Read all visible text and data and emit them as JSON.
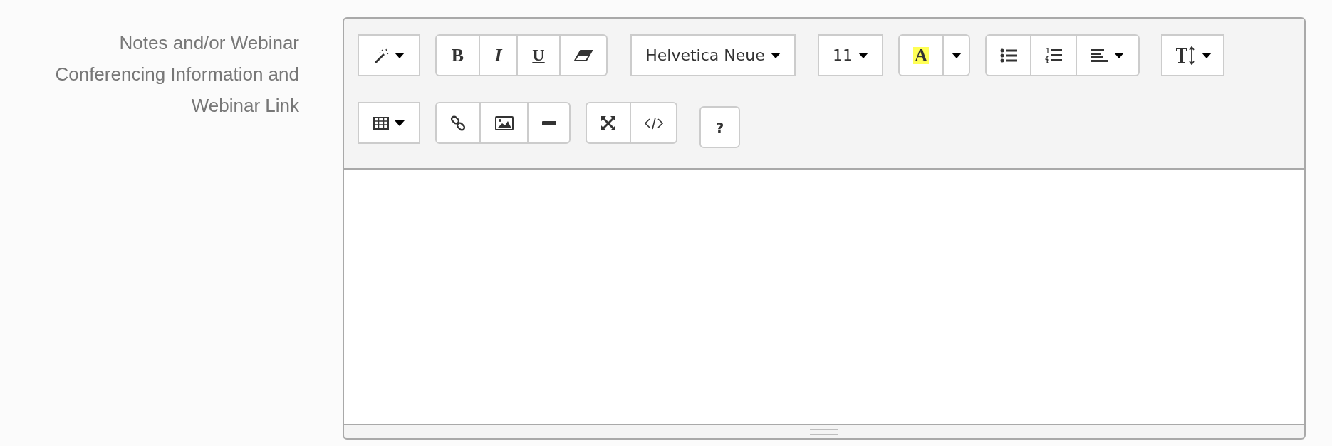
{
  "field": {
    "label": "Notes and/or Webinar Conferencing Information and Webinar Link"
  },
  "toolbar": {
    "rows": [
      {
        "groups": [
          {
            "buttons": [
              {
                "kind": "magic",
                "dropdown": true
              }
            ]
          },
          {
            "buttons": [
              {
                "kind": "bold",
                "text": "B"
              },
              {
                "kind": "italic",
                "text": "I"
              },
              {
                "kind": "underline",
                "text": "U"
              },
              {
                "kind": "eraser"
              }
            ]
          },
          {
            "buttons": [
              {
                "kind": "font",
                "text": "Helvetica Neue",
                "dropdown": true
              }
            ]
          },
          {
            "buttons": [
              {
                "kind": "size",
                "text": "11",
                "dropdown": true
              }
            ]
          },
          {
            "buttons": [
              {
                "kind": "color",
                "text": "A"
              },
              {
                "kind": "caret",
                "dropdown": true
              }
            ]
          },
          {
            "buttons": [
              {
                "kind": "bullets"
              },
              {
                "kind": "numbers"
              },
              {
                "kind": "align",
                "dropdown": true
              }
            ]
          },
          {
            "buttons": [
              {
                "kind": "height",
                "dropdown": true
              }
            ]
          }
        ]
      },
      {
        "groups": [
          {
            "buttons": [
              {
                "kind": "table",
                "dropdown": true
              }
            ]
          },
          {
            "buttons": [
              {
                "kind": "link"
              },
              {
                "kind": "image"
              },
              {
                "kind": "rule"
              }
            ]
          },
          {
            "buttons": [
              {
                "kind": "fullscreen"
              },
              {
                "kind": "code"
              }
            ]
          },
          {
            "buttons": [
              {
                "kind": "help",
                "text": "?"
              }
            ]
          }
        ]
      }
    ]
  }
}
